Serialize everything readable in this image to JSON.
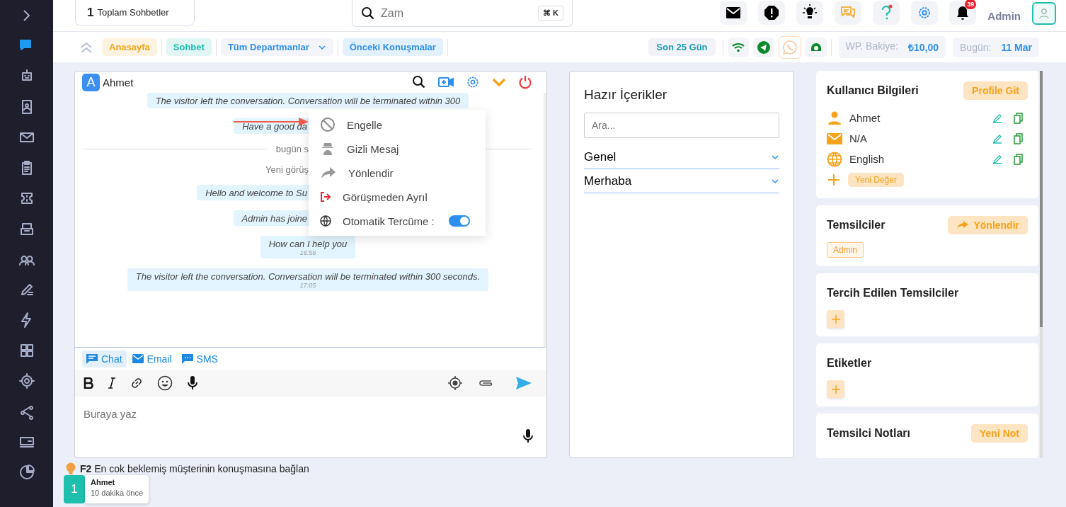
{
  "sidebar": {
    "items": [
      {
        "selected": true
      },
      {
        "selected": false
      },
      {
        "selected": false
      },
      {
        "selected": false
      },
      {
        "selected": false
      },
      {
        "selected": false
      },
      {
        "selected": false
      },
      {
        "selected": false
      },
      {
        "selected": false
      },
      {
        "selected": false
      },
      {
        "selected": false
      },
      {
        "selected": false
      },
      {
        "selected": false
      },
      {
        "selected": false
      },
      {
        "selected": false
      }
    ]
  },
  "header": {
    "total_count": "1",
    "total_label": "Toplam Sohbetler",
    "search": {
      "placeholder": "Zam",
      "shortcut": "⌘ K"
    },
    "notification_count": "39",
    "user": "Admin"
  },
  "toolbar": {
    "nav": [
      {
        "label": "Anasayfa",
        "kind": "tag",
        "color": "#f7a21b"
      },
      {
        "label": "Sohbet",
        "kind": "tag",
        "color": "#1fbfae"
      },
      {
        "label": "Tüm Departmanlar",
        "kind": "dropdown",
        "color": "#2f8ff0"
      },
      {
        "label": "Önceki Konuşmalar",
        "kind": "tag",
        "color": "#2f8ff0"
      }
    ],
    "period": "Son 25 Gün",
    "balance": {
      "label": "WP. Bakiye:",
      "value": "₺10,00"
    },
    "today": {
      "label": "Bugün:",
      "value": "11 Mar"
    }
  },
  "chat": {
    "avatar_letter": "A",
    "visitor": "Ahmet",
    "messages": [
      {
        "kind": "bubble",
        "text": "The visitor left the conversation. Conversation will be terminated within 300"
      },
      {
        "kind": "partial",
        "text": "Have a good da"
      },
      {
        "kind": "divider",
        "text": "bugün s"
      },
      {
        "kind": "system",
        "text": "Yeni görüş"
      },
      {
        "kind": "partial",
        "text": "Hello and welcome to Su"
      },
      {
        "kind": "partial",
        "text": "Admin has joine"
      },
      {
        "kind": "bubble",
        "text": "How can I help you",
        "time": "16:56"
      },
      {
        "kind": "bubble",
        "text": "The visitor left the conversation. Conversation will be terminated within 300 seconds.",
        "time": "17:05"
      }
    ],
    "menu": {
      "items": [
        {
          "kind": "action",
          "label": "Engelle"
        },
        {
          "kind": "action",
          "label": "Gizli Mesaj"
        },
        {
          "kind": "action",
          "label": "Yönlendir"
        },
        {
          "kind": "action",
          "label": "Görüşmeden Ayrıl"
        },
        {
          "kind": "toggle",
          "label": "Otomatik Tercüme :",
          "on": true
        }
      ]
    },
    "channels": [
      {
        "label": "Chat",
        "selected": true
      },
      {
        "label": "Email",
        "selected": false
      },
      {
        "label": "SMS",
        "selected": false
      }
    ],
    "composer": {
      "placeholder": "Buraya yaz"
    }
  },
  "ready_contents": {
    "title": "Hazır İçerikler",
    "search": {
      "placeholder": "Ara..."
    },
    "groups": [
      {
        "label": "Genel"
      },
      {
        "label": "Merhaba"
      }
    ]
  },
  "user_info": {
    "title": "Kullanıcı Bilgileri",
    "button": "Profile Git",
    "fields": [
      {
        "value": "Ahmet"
      },
      {
        "value": "N/A"
      },
      {
        "value": "English"
      }
    ],
    "add_label": "Yeni Değer"
  },
  "representatives": {
    "title": "Temsilciler",
    "button": "Yönlendir",
    "tags": [
      "Admin"
    ]
  },
  "preferred": {
    "title": "Tercih Edilen Temsilciler"
  },
  "labels": {
    "title": "Etiketler"
  },
  "notes": {
    "title": "Temsilci Notları",
    "button": "Yeni Not"
  },
  "footer": {
    "hint": "**F2** En cok beklemiş müşterinin konuşmasına bağlan",
    "queue": [
      {
        "count": "1",
        "name": "Ahmet",
        "time": "10 dakika önce"
      }
    ]
  }
}
